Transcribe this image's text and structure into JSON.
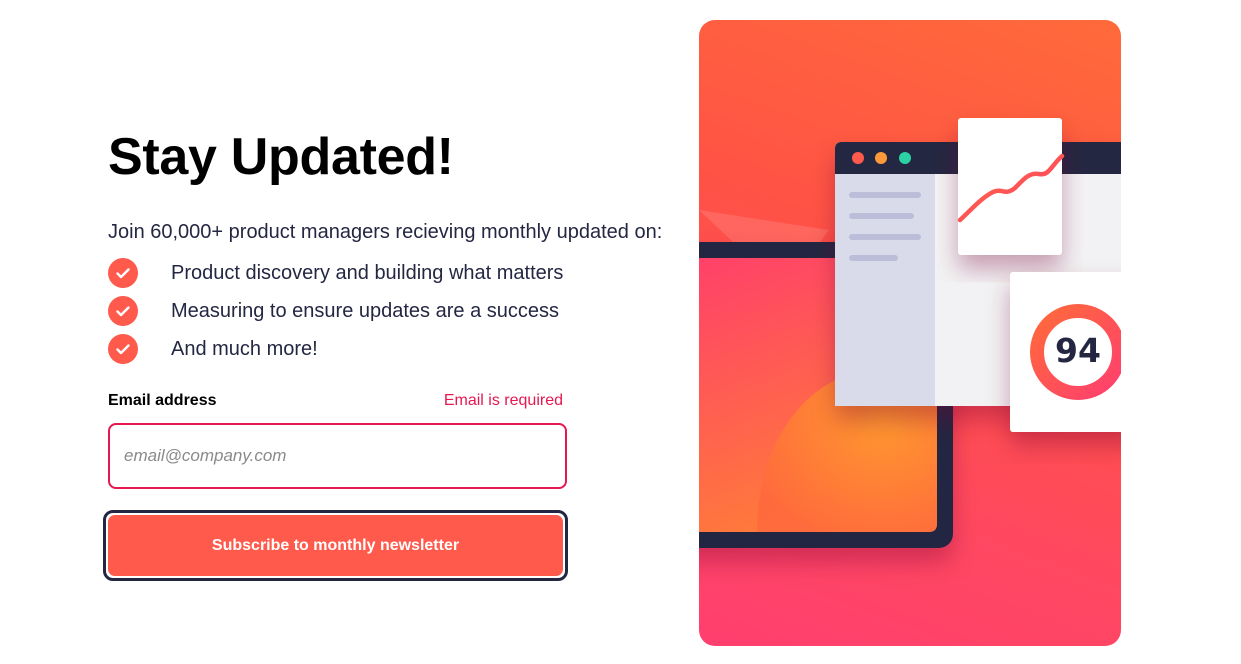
{
  "title": "Stay Updated!",
  "intro": "Join 60,000+ product managers recieving monthly updated on:",
  "features": [
    "Product discovery and building what matters",
    "Measuring to ensure updates are a success",
    "And much more!"
  ],
  "form": {
    "label": "Email address",
    "error": "Email is required",
    "placeholder": "email@company.com",
    "value": "",
    "button": "Subscribe to monthly newsletter"
  },
  "illustration": {
    "score": "94"
  },
  "colors": {
    "accent": "#ff5a4b",
    "error": "#e7174f",
    "dark": "#242742"
  }
}
